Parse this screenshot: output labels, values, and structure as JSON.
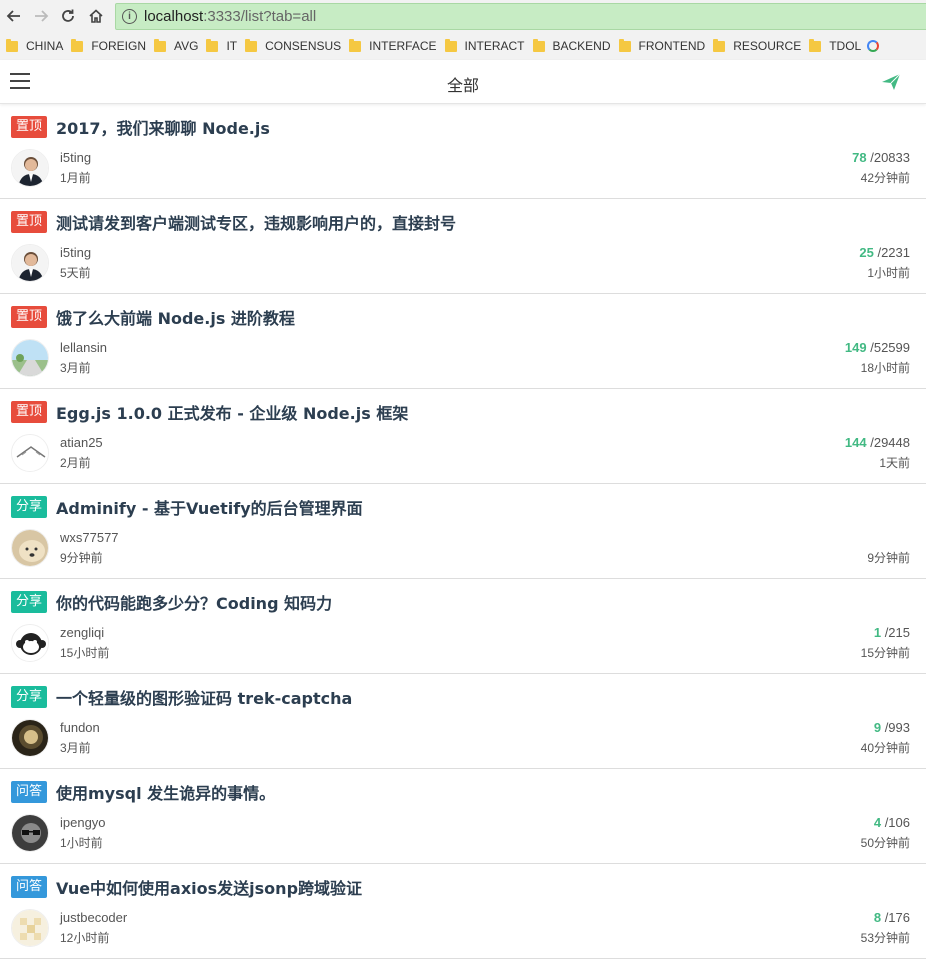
{
  "browser": {
    "url_host": "localhost",
    "url_path": ":3333/list?tab=all",
    "bookmarks": [
      "CHINA",
      "FOREIGN",
      "AVG",
      "IT",
      "CONSENSUS",
      "INTERFACE",
      "INTERACT",
      "BACKEND",
      "FRONTEND",
      "RESOURCE",
      "TDOL"
    ]
  },
  "header": {
    "title": "全部"
  },
  "colors": {
    "accent": "#42b983",
    "top_tag": "#e74c3c",
    "share_tag": "#1abc9c",
    "ask_tag": "#3498db"
  },
  "topics": [
    {
      "tag": "置顶",
      "tag_type": "top",
      "title": "2017，我们来聊聊 Node.js",
      "author": "i5ting",
      "created": "1月前",
      "reply": "78",
      "visit": " /20833",
      "last_reply": "42分钟前",
      "avatar": "person"
    },
    {
      "tag": "置顶",
      "tag_type": "top",
      "title": "测试请发到客户端测试专区，违规影响用户的，直接封号",
      "author": "i5ting",
      "created": "5天前",
      "reply": "25",
      "visit": " /2231",
      "last_reply": "1小时前",
      "avatar": "person"
    },
    {
      "tag": "置顶",
      "tag_type": "top",
      "title": "饿了么大前端 Node.js 进阶教程",
      "author": "lellansin",
      "created": "3月前",
      "reply": "149",
      "visit": " /52599",
      "last_reply": "18小时前",
      "avatar": "road"
    },
    {
      "tag": "置顶",
      "tag_type": "top",
      "title": "Egg.js 1.0.0 正式发布 - 企业级 Node.js 框架",
      "author": "atian25",
      "created": "2月前",
      "reply": "144",
      "visit": " /29448",
      "last_reply": "1天前",
      "avatar": "sketch"
    },
    {
      "tag": "分享",
      "tag_type": "share",
      "title": "Adminify - 基于Vuetify的后台管理界面",
      "author": "wxs77577",
      "created": "9分钟前",
      "reply": "",
      "visit": "",
      "last_reply": "9分钟前",
      "avatar": "dog"
    },
    {
      "tag": "分享",
      "tag_type": "share",
      "title": "你的代码能跑多少分？Coding 知码力",
      "author": "zengliqi",
      "created": "15小时前",
      "reply": "1",
      "visit": " /215",
      "last_reply": "15分钟前",
      "avatar": "monkey"
    },
    {
      "tag": "分享",
      "tag_type": "share",
      "title": "一个轻量级的图形验证码 trek-captcha",
      "author": "fundon",
      "created": "3月前",
      "reply": "9",
      "visit": " /993",
      "last_reply": "40分钟前",
      "avatar": "dark"
    },
    {
      "tag": "问答",
      "tag_type": "ask",
      "title": "使用mysql 发生诡异的事情。",
      "author": "ipengyo",
      "created": "1小时前",
      "reply": "4",
      "visit": " /106",
      "last_reply": "50分钟前",
      "avatar": "glasses"
    },
    {
      "tag": "问答",
      "tag_type": "ask",
      "title": "Vue中如何使用axios发送jsonp跨域验证",
      "author": "justbecoder",
      "created": "12小时前",
      "reply": "8",
      "visit": " /176",
      "last_reply": "53分钟前",
      "avatar": "pixel"
    }
  ]
}
